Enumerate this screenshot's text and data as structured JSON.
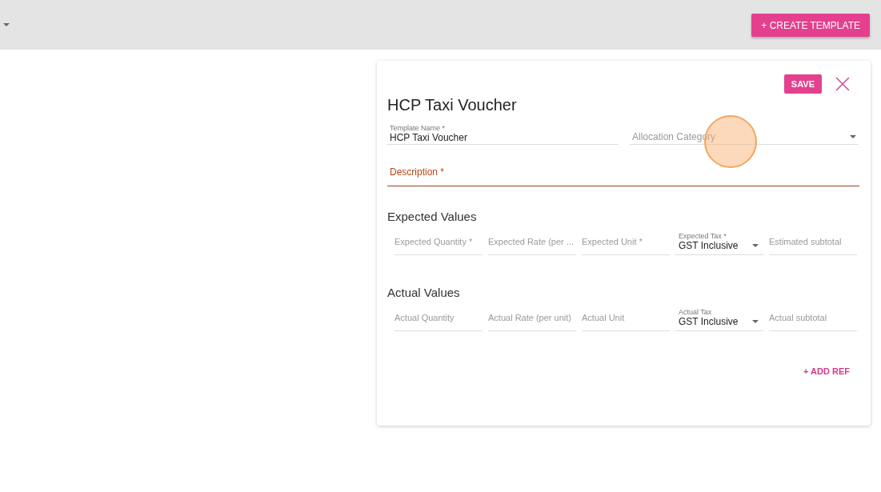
{
  "toolbar": {
    "create_button": "+ CREATE TEMPLATE"
  },
  "form": {
    "title": "HCP Taxi Voucher",
    "save_button": "SAVE",
    "template_name": {
      "label": "Template Name *",
      "value": "HCP Taxi Voucher"
    },
    "allocation_category": {
      "placeholder": "Allocation Category"
    },
    "description": {
      "placeholder": "Description *",
      "invalid": true
    },
    "sections": [
      {
        "heading": "Expected Values",
        "fields": [
          {
            "kind": "text",
            "placeholder": "Expected Quantity *"
          },
          {
            "kind": "text",
            "placeholder": "Expected Rate (per ..."
          },
          {
            "kind": "text",
            "placeholder": "Expected Unit *"
          },
          {
            "kind": "select",
            "label": "Expected Tax *",
            "value": "GST Inclusive"
          },
          {
            "kind": "text",
            "placeholder": "Estimated subtotal"
          }
        ]
      },
      {
        "heading": "Actual Values",
        "fields": [
          {
            "kind": "text",
            "placeholder": "Actual Quantity"
          },
          {
            "kind": "text",
            "placeholder": "Actual Rate (per unit)"
          },
          {
            "kind": "text",
            "placeholder": "Actual Unit"
          },
          {
            "kind": "select",
            "label": "Actual Tax",
            "value": "GST Inclusive"
          },
          {
            "kind": "text",
            "placeholder": "Actual subtotal"
          }
        ]
      }
    ],
    "add_ref_button": "+ ADD REF"
  }
}
